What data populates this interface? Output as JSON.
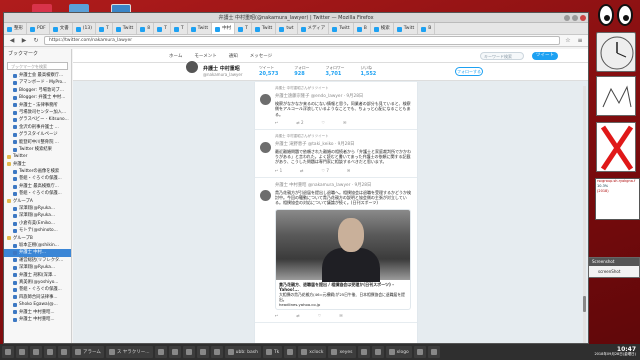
{
  "window": {
    "title": "弁護士 中村重昭(@nakamura_lawyer) | Twitter — Mozilla Firefox"
  },
  "tabs": [
    {
      "label": "整形"
    },
    {
      "label": "PDF"
    },
    {
      "label": "文書"
    },
    {
      "label": "(13)"
    },
    {
      "label": "T"
    },
    {
      "label": "Twitt"
    },
    {
      "label": "8"
    },
    {
      "label": "T"
    },
    {
      "label": "T"
    },
    {
      "label": "Twitt"
    },
    {
      "label": "中村"
    },
    {
      "label": "T"
    },
    {
      "label": "Twitt"
    },
    {
      "label": "twt"
    },
    {
      "label": "メディア"
    },
    {
      "label": "Twitt"
    },
    {
      "label": "B"
    },
    {
      "label": "検索"
    },
    {
      "label": "Twitt"
    },
    {
      "label": "B"
    }
  ],
  "url": "https://twitter.com/nakamura_lawyer",
  "sidebar": {
    "header": "ブックマーク",
    "search_placeholder": "ブックマークを検索",
    "items": [
      {
        "label": "弁護士会 最高検察庁...",
        "folder": false
      },
      {
        "label": "アマンボード - MyPro...",
        "folder": false
      },
      {
        "label": "Blogger: 弓場敦司ブ...",
        "folder": false
      },
      {
        "label": "Blogger: 弁護士 中村...",
        "folder": false
      },
      {
        "label": "弁護士・法律事務所",
        "folder": false
      },
      {
        "label": "弓場敦司センター加入...",
        "folder": false
      },
      {
        "label": "グラスベビー - Kitsuno...",
        "folder": false
      },
      {
        "label": "金沢の刑事弁護士 ...",
        "folder": false
      },
      {
        "label": "グラスタイルページ",
        "folder": false
      },
      {
        "label": "能登町中川整骨院 ...",
        "folder": false
      },
      {
        "label": "Twitter 検索結果",
        "folder": false
      },
      {
        "label": "Twitter",
        "folder": true
      },
      {
        "label": "弁護士",
        "folder": true
      },
      {
        "label": "Twitterの画像を検索",
        "folder": false
      },
      {
        "label": "巻組・ぐろぐの保護...",
        "folder": false
      },
      {
        "label": "弁護士 最高検察庁...",
        "folder": false
      },
      {
        "label": "巻組・ぐろぐの保護...",
        "folder": false
      },
      {
        "label": "グループA",
        "folder": true
      },
      {
        "label": "深澤翔(@Ryuka...",
        "folder": false
      },
      {
        "label": "深澤翔(@Ryuka...",
        "folder": false
      },
      {
        "label": "小倉有美(Emiko...",
        "folder": false
      },
      {
        "label": "モトテ(@shinoto...",
        "folder": false
      },
      {
        "label": "グループB",
        "folder": true
      },
      {
        "label": "坂本正樹(@shikin...",
        "folder": false
      },
      {
        "label": "弁護士 中村...",
        "folder": false
      },
      {
        "label": "運営総括(リフレクタ...",
        "folder": false
      },
      {
        "label": "深澤翔(@Ryuka...",
        "folder": false
      },
      {
        "label": "弁護士 刑和(深澤...",
        "folder": false
      },
      {
        "label": "真美術(@yoshiyo...",
        "folder": false
      },
      {
        "label": "巻組・ぐろぐの保護...",
        "folder": false
      },
      {
        "label": "四旅師合同法律事...",
        "folder": false
      },
      {
        "label": "Shoko Egawa(@...",
        "folder": false
      },
      {
        "label": "弁護士 中村重昭...",
        "folder": false
      },
      {
        "label": "弁護士 中村重昭...",
        "folder": false
      }
    ],
    "selected_index": 24
  },
  "twitter_nav": {
    "home": "ホーム",
    "moments": "モーメント",
    "notifications": "通知",
    "messages": "メッセージ",
    "search_placeholder": "キーワード検索",
    "tweet_button": "ツイート"
  },
  "profile": {
    "name": "弁護士 中村重昭",
    "handle": "@nakamura_lawyer",
    "stats": [
      {
        "label": "ツイート",
        "value": "20,573"
      },
      {
        "label": "フォロー",
        "value": "928"
      },
      {
        "label": "フォロワー",
        "value": "3,701"
      },
      {
        "label": "いいね",
        "value": "1,552"
      }
    ],
    "follow_button": "フォローする"
  },
  "tweets": [
    {
      "retweeted_by": "弁護士 中村重昭さんがリツイート",
      "name": "弁護士遠藤宗隆子",
      "meta": "@endo_lawyer · 9月28日",
      "text": "検察がなかなか来るのにない情報と思う。同業者の部分も見ていると、検察側をアルコール浮浪しているようなことでも、ちょっと心配になることもある。",
      "actions": [
        "",
        "2",
        "",
        ""
      ]
    },
    {
      "retweeted_by": "弁護士 中村重昭さんがリツイート",
      "name": "弁護士 滝野恵子",
      "meta": "@taki_keiko · 9月28日",
      "text": "最近離婚問題で依頼された離婚の相続者から「弁護士と家庭裁判所でかかわりがある」と言われた。よく読むと書いてあった弁護士の依頼に関する記載があり、こうした問題は専門家に相談するべきだと思います。",
      "actions": [
        "1",
        "",
        "7",
        ""
      ]
    },
    {
      "retweeted_by": "",
      "name": "弁護士 中村重昭",
      "meta": "@nakamura_lawyer · 9月28日",
      "text": "貴乃花親方が引退届を提出し退職へ。相撲協会は退職を受理するかどうか検討中。今回の騒動について貴乃花親方の説明と協会側の主張が対立している。相撲協会の対応について議論が続く。(日刊スポーツ)",
      "card_title": "貴乃花親方、退職届を提出 / 相撲協会は受理か(日刊スポーツ) - Yahoo!...",
      "card_desc": "大相撲の貴乃花親方(46=元横綱)が25日午後、日本相撲協会に退職届を提出。",
      "card_domain": "headlines.yahoo.co.jp",
      "actions": [
        "",
        "",
        "",
        ""
      ]
    }
  ],
  "widgets": {
    "graph_labels": [
      "rscgroup.sh.ryokgna.f",
      "10.3%",
      "(2018)"
    ],
    "popup_title": "Screenshot",
    "popup_body": "screenShot"
  },
  "taskbar": {
    "items": [
      "",
      "",
      "",
      "",
      "",
      "",
      "",
      "",
      "アラーム",
      "ス ヤラクリー...",
      "",
      "",
      "",
      "",
      "",
      "",
      "",
      "",
      "",
      "",
      "ubb: bash",
      "Tk",
      "",
      "",
      "xclock",
      "xeyes",
      "",
      "",
      "",
      "xlogo",
      "",
      "",
      "",
      ""
    ],
    "time": "10:47",
    "date": "2018年09月28日(金曜日)"
  },
  "colors": {
    "twitter_blue": "#1da1f2",
    "selection_blue": "#3b86d6",
    "desktop_red": "#9c1616"
  }
}
